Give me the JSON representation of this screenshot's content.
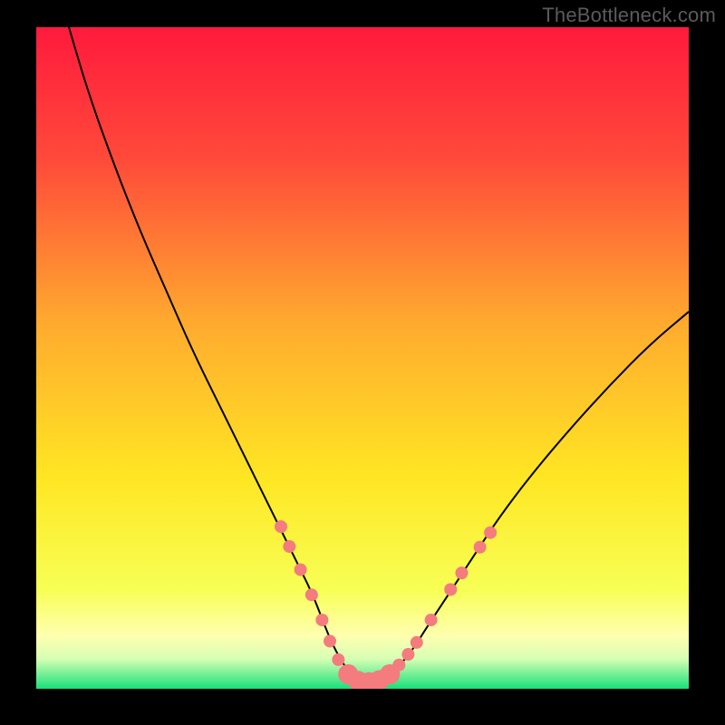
{
  "watermark": "TheBottleneck.com",
  "colors": {
    "frame": "#000000",
    "curve": "#000000",
    "dot_fill": "#f47b7e",
    "gradient_stops": [
      {
        "offset": "0%",
        "color": "#ff1a3c"
      },
      {
        "offset": "20%",
        "color": "#ff4a3a"
      },
      {
        "offset": "45%",
        "color": "#ffab2e"
      },
      {
        "offset": "68%",
        "color": "#ffe623"
      },
      {
        "offset": "85%",
        "color": "#f7ff55"
      },
      {
        "offset": "92%",
        "color": "#ffffb0"
      },
      {
        "offset": "95.5%",
        "color": "#d6ffb4"
      },
      {
        "offset": "100%",
        "color": "#18e07a"
      }
    ]
  },
  "chart_data": {
    "type": "line",
    "title": "",
    "xlabel": "",
    "ylabel": "",
    "xlim": [
      0,
      100
    ],
    "ylim": [
      0,
      100
    ],
    "grid": false,
    "series": [
      {
        "name": "bottleneck-curve",
        "x": [
          5,
          8,
          12,
          16,
          20,
          24,
          28,
          32,
          35,
          38,
          40.5,
          42.5,
          44,
          45.5,
          47,
          48.5,
          50,
          51.5,
          53,
          55,
          57.5,
          60,
          63,
          67,
          71,
          76,
          82,
          88,
          94,
          100
        ],
        "y": [
          100,
          90,
          79,
          69,
          60,
          51,
          43,
          35,
          29,
          23,
          18,
          14,
          10,
          6.5,
          3.8,
          1.8,
          1.0,
          1.0,
          1.4,
          2.8,
          5.6,
          9.5,
          14,
          20,
          26,
          32.5,
          39.5,
          46,
          52,
          57
        ]
      }
    ],
    "highlight_points": {
      "name": "salmon-dots",
      "color": "#f47b7e",
      "radius_small": 7,
      "radius_large": 11,
      "points": [
        {
          "x": 37.5,
          "y": 24.5,
          "r": 7
        },
        {
          "x": 38.8,
          "y": 21.5,
          "r": 7
        },
        {
          "x": 40.5,
          "y": 18.0,
          "r": 7
        },
        {
          "x": 42.2,
          "y": 14.2,
          "r": 7
        },
        {
          "x": 43.8,
          "y": 10.4,
          "r": 7
        },
        {
          "x": 45.0,
          "y": 7.2,
          "r": 7
        },
        {
          "x": 46.3,
          "y": 4.4,
          "r": 7
        },
        {
          "x": 47.8,
          "y": 2.2,
          "r": 11
        },
        {
          "x": 49.3,
          "y": 1.2,
          "r": 11
        },
        {
          "x": 51.0,
          "y": 1.0,
          "r": 11
        },
        {
          "x": 52.6,
          "y": 1.3,
          "r": 11
        },
        {
          "x": 54.2,
          "y": 2.2,
          "r": 11
        },
        {
          "x": 55.6,
          "y": 3.6,
          "r": 7
        },
        {
          "x": 57.0,
          "y": 5.2,
          "r": 7
        },
        {
          "x": 58.3,
          "y": 7.0,
          "r": 7
        },
        {
          "x": 60.5,
          "y": 10.4,
          "r": 7
        },
        {
          "x": 63.5,
          "y": 15.0,
          "r": 7
        },
        {
          "x": 65.2,
          "y": 17.5,
          "r": 7
        },
        {
          "x": 68.0,
          "y": 21.4,
          "r": 7
        },
        {
          "x": 69.6,
          "y": 23.6,
          "r": 7
        }
      ]
    }
  }
}
